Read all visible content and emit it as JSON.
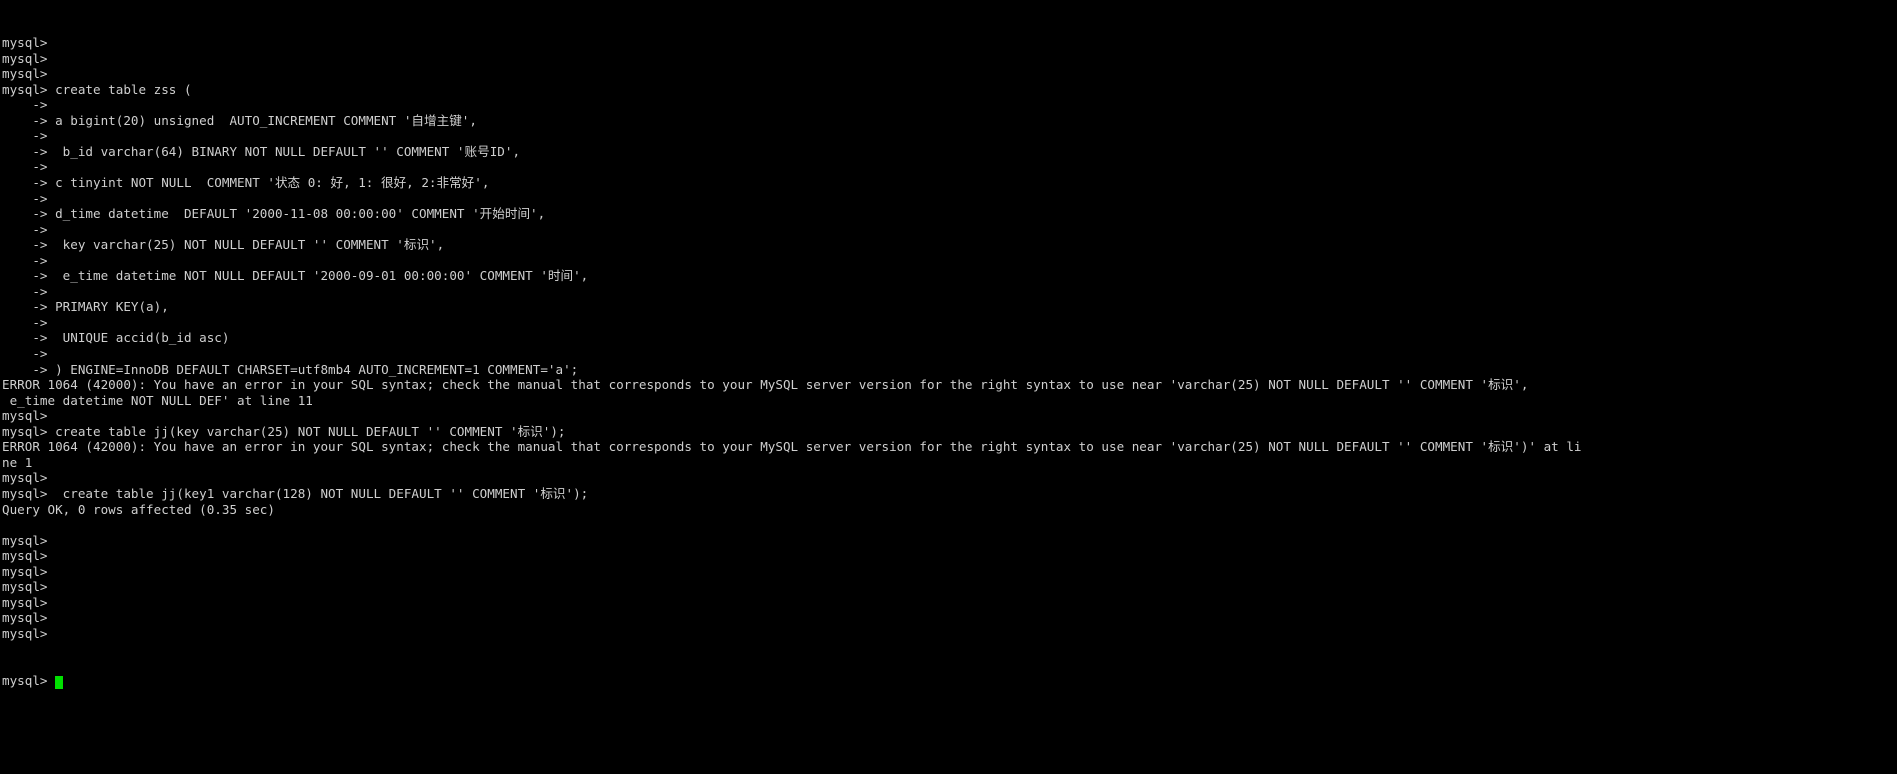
{
  "terminal": {
    "app": "mysql-client",
    "colors": {
      "background": "#000000",
      "foreground": "#cfcfcf",
      "cursor": "#00e000"
    },
    "prompt": "mysql>",
    "continuation_prompt": "->",
    "lines": [
      "mysql>",
      "mysql>",
      "mysql>",
      "mysql> create table zss (",
      "    ->",
      "    -> a bigint(20) unsigned  AUTO_INCREMENT COMMENT '自增主键',",
      "    ->",
      "    ->  b_id varchar(64) BINARY NOT NULL DEFAULT '' COMMENT '账号ID',",
      "    ->",
      "    -> c tinyint NOT NULL  COMMENT '状态 0: 好, 1: 很好, 2:非常好',",
      "    ->",
      "    -> d_time datetime  DEFAULT '2000-11-08 00:00:00' COMMENT '开始时间',",
      "    ->",
      "    ->  key varchar(25) NOT NULL DEFAULT '' COMMENT '标识',",
      "    ->",
      "    ->  e_time datetime NOT NULL DEFAULT '2000-09-01 00:00:00' COMMENT '时间',",
      "    ->",
      "    -> PRIMARY KEY(a),",
      "    ->",
      "    ->  UNIQUE accid(b_id asc)",
      "    ->",
      "    -> ) ENGINE=InnoDB DEFAULT CHARSET=utf8mb4 AUTO_INCREMENT=1 COMMENT='a';",
      "ERROR 1064 (42000): You have an error in your SQL syntax; check the manual that corresponds to your MySQL server version for the right syntax to use near 'varchar(25) NOT NULL DEFAULT '' COMMENT '标识',",
      " e_time datetime NOT NULL DEF' at line 11",
      "mysql>",
      "mysql> create table jj(key varchar(25) NOT NULL DEFAULT '' COMMENT '标识');",
      "ERROR 1064 (42000): You have an error in your SQL syntax; check the manual that corresponds to your MySQL server version for the right syntax to use near 'varchar(25) NOT NULL DEFAULT '' COMMENT '标识')' at li",
      "ne 1",
      "mysql>",
      "mysql>  create table jj(key1 varchar(128) NOT NULL DEFAULT '' COMMENT '标识');",
      "Query OK, 0 rows affected (0.35 sec)",
      "",
      "mysql>",
      "mysql>",
      "mysql>",
      "mysql>",
      "mysql>",
      "mysql>",
      "mysql>"
    ],
    "last_line_prefix": "mysql> ",
    "statements": {
      "create_zss": "create table zss (",
      "create_jj_key": "create table jj(key varchar(25) NOT NULL DEFAULT '' COMMENT '标识');",
      "create_jj_key1": " create table jj(key1 varchar(128) NOT NULL DEFAULT '' COMMENT '标识');"
    },
    "results": {
      "error_code": "ERROR 1064 (42000)",
      "success_message": "Query OK, 0 rows affected (0.35 sec)",
      "rows_affected": "0",
      "duration": "0.35 sec",
      "error_line_1": "at line 11",
      "error_line_2": "ne 1"
    }
  }
}
